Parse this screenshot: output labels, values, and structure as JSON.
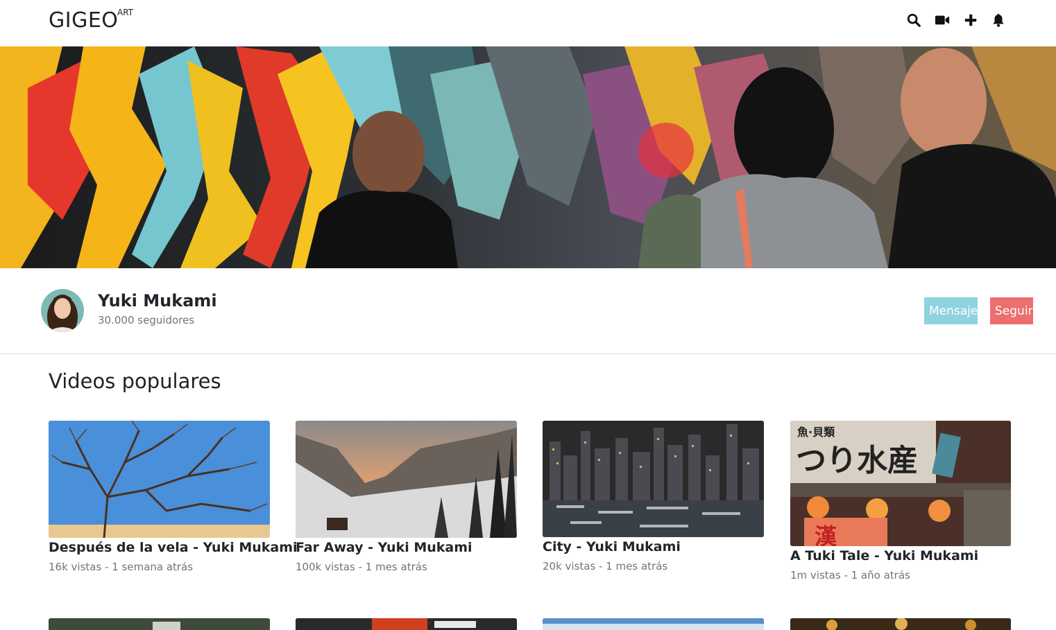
{
  "brand": {
    "name": "GIGEO",
    "sup": "ART"
  },
  "nav": {
    "icons": [
      "search-icon",
      "video-camera-icon",
      "plus-icon",
      "bell-icon"
    ]
  },
  "profile": {
    "name": "Yuki Mukami",
    "followers": "30.000 seguidores",
    "message_label": "Mensaje",
    "follow_label": "Seguir"
  },
  "section": {
    "title": "Videos populares"
  },
  "videos": [
    {
      "title": "Después de la vela - Yuki Mukami",
      "meta": "16k vistas - 1 semana atrás"
    },
    {
      "title": "Far Away - Yuki Mukami",
      "meta": "100k vistas - 1 mes atrás"
    },
    {
      "title": "City - Yuki Mukami",
      "meta": "20k vistas - 1 mes atrás"
    },
    {
      "title": "A Tuki Tale - Yuki Mukami",
      "meta": "1m vistas - 1 año atrás"
    }
  ],
  "colors": {
    "message_button": "#8fd3df",
    "follow_button": "#ec6e6e",
    "muted_text": "#6c757d"
  }
}
